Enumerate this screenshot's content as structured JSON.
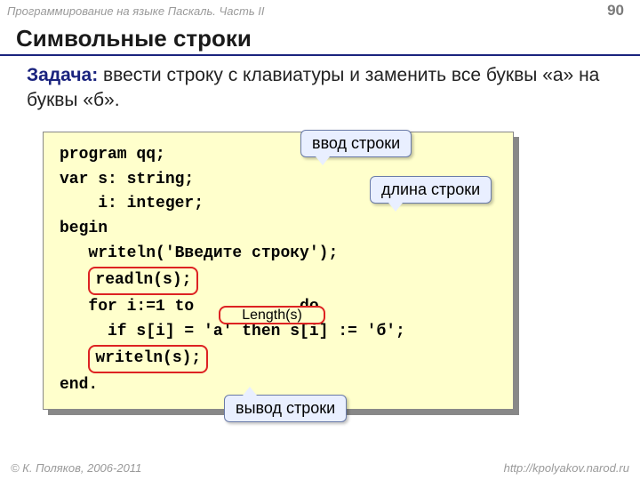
{
  "header": {
    "course": "Программирование на языке Паскаль. Часть II",
    "page": "90"
  },
  "title": "Символьные строки",
  "task": {
    "label": "Задача:",
    "text": " ввести строку с клавиатуры и заменить все буквы «а» на буквы «б»."
  },
  "code": {
    "l1": "program qq;",
    "l2": "var s: string;",
    "l3": "    i: integer;",
    "l4": "begin",
    "l5": "   writeln('Введите строку');",
    "l6_pre": "   ",
    "l6_hl": "readln(s);",
    "l7_pre": "   for i:=1 to ",
    "l7_post": " do",
    "l7_len": "Length(s)",
    "l8": "     if s[i] = 'а' then s[i] := 'б';",
    "l9_pre": "   ",
    "l9_hl": "writeln(s);",
    "l10": "end."
  },
  "callouts": {
    "c1": "ввод строки",
    "c2": "длина строки",
    "c3": "вывод строки"
  },
  "footer": {
    "left": "© К. Поляков, 2006-2011",
    "right": "http://kpolyakov.narod.ru"
  }
}
